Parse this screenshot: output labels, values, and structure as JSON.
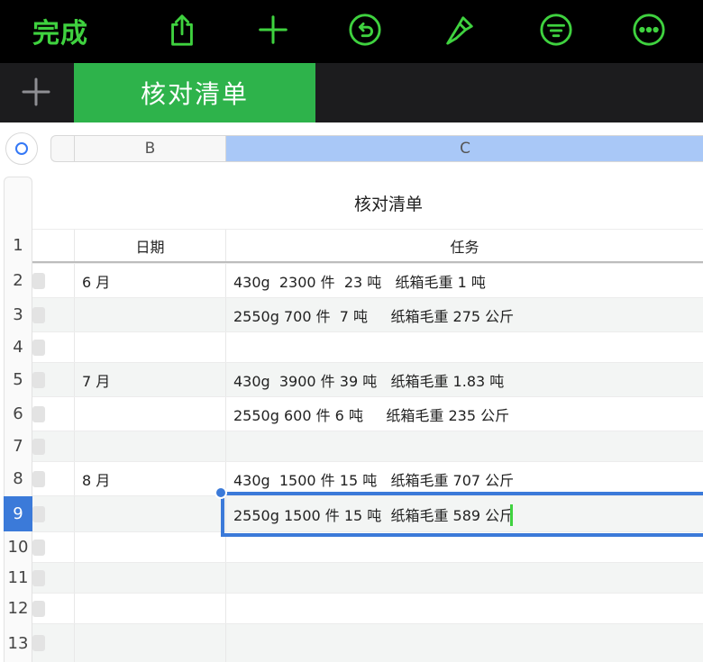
{
  "toolbar": {
    "done_label": "完成",
    "icons": [
      "share-icon",
      "add-icon",
      "undo-icon",
      "format-brush-icon",
      "organize-icon",
      "more-icon"
    ],
    "accent": "#3fd23f"
  },
  "tabs": {
    "active_sheet": "核对清单",
    "tab_color": "#2eb34b"
  },
  "columns": {
    "b": "B",
    "c": "C",
    "selected_color": "#a9c8f7"
  },
  "table": {
    "title": "核对清单",
    "header": {
      "num": "1",
      "date": "日期",
      "task": "任务"
    },
    "rows": [
      {
        "num": "2",
        "date": "6 月",
        "task": "430g  2300 件  23 吨   纸箱毛重 1 吨"
      },
      {
        "num": "3",
        "date": "",
        "task": "2550g 700 件  7 吨     纸箱毛重 275 公斤"
      },
      {
        "num": "4",
        "date": "",
        "task": ""
      },
      {
        "num": "5",
        "date": "7 月",
        "task": "430g  3900 件 39 吨   纸箱毛重 1.83 吨"
      },
      {
        "num": "6",
        "date": "",
        "task": "2550g 600 件 6 吨     纸箱毛重 235 公斤"
      },
      {
        "num": "7",
        "date": "",
        "task": ""
      },
      {
        "num": "8",
        "date": "8 月",
        "task": "430g  1500 件 15 吨   纸箱毛重 707 公斤"
      },
      {
        "num": "9",
        "date": "",
        "task": "2550g 1500 件 15 吨  纸箱毛重 589 公斤"
      },
      {
        "num": "10",
        "date": "",
        "task": ""
      },
      {
        "num": "11",
        "date": "",
        "task": ""
      },
      {
        "num": "12",
        "date": "",
        "task": ""
      },
      {
        "num": "13",
        "date": "",
        "task": ""
      }
    ],
    "selection_color": "#3b7ad9"
  }
}
